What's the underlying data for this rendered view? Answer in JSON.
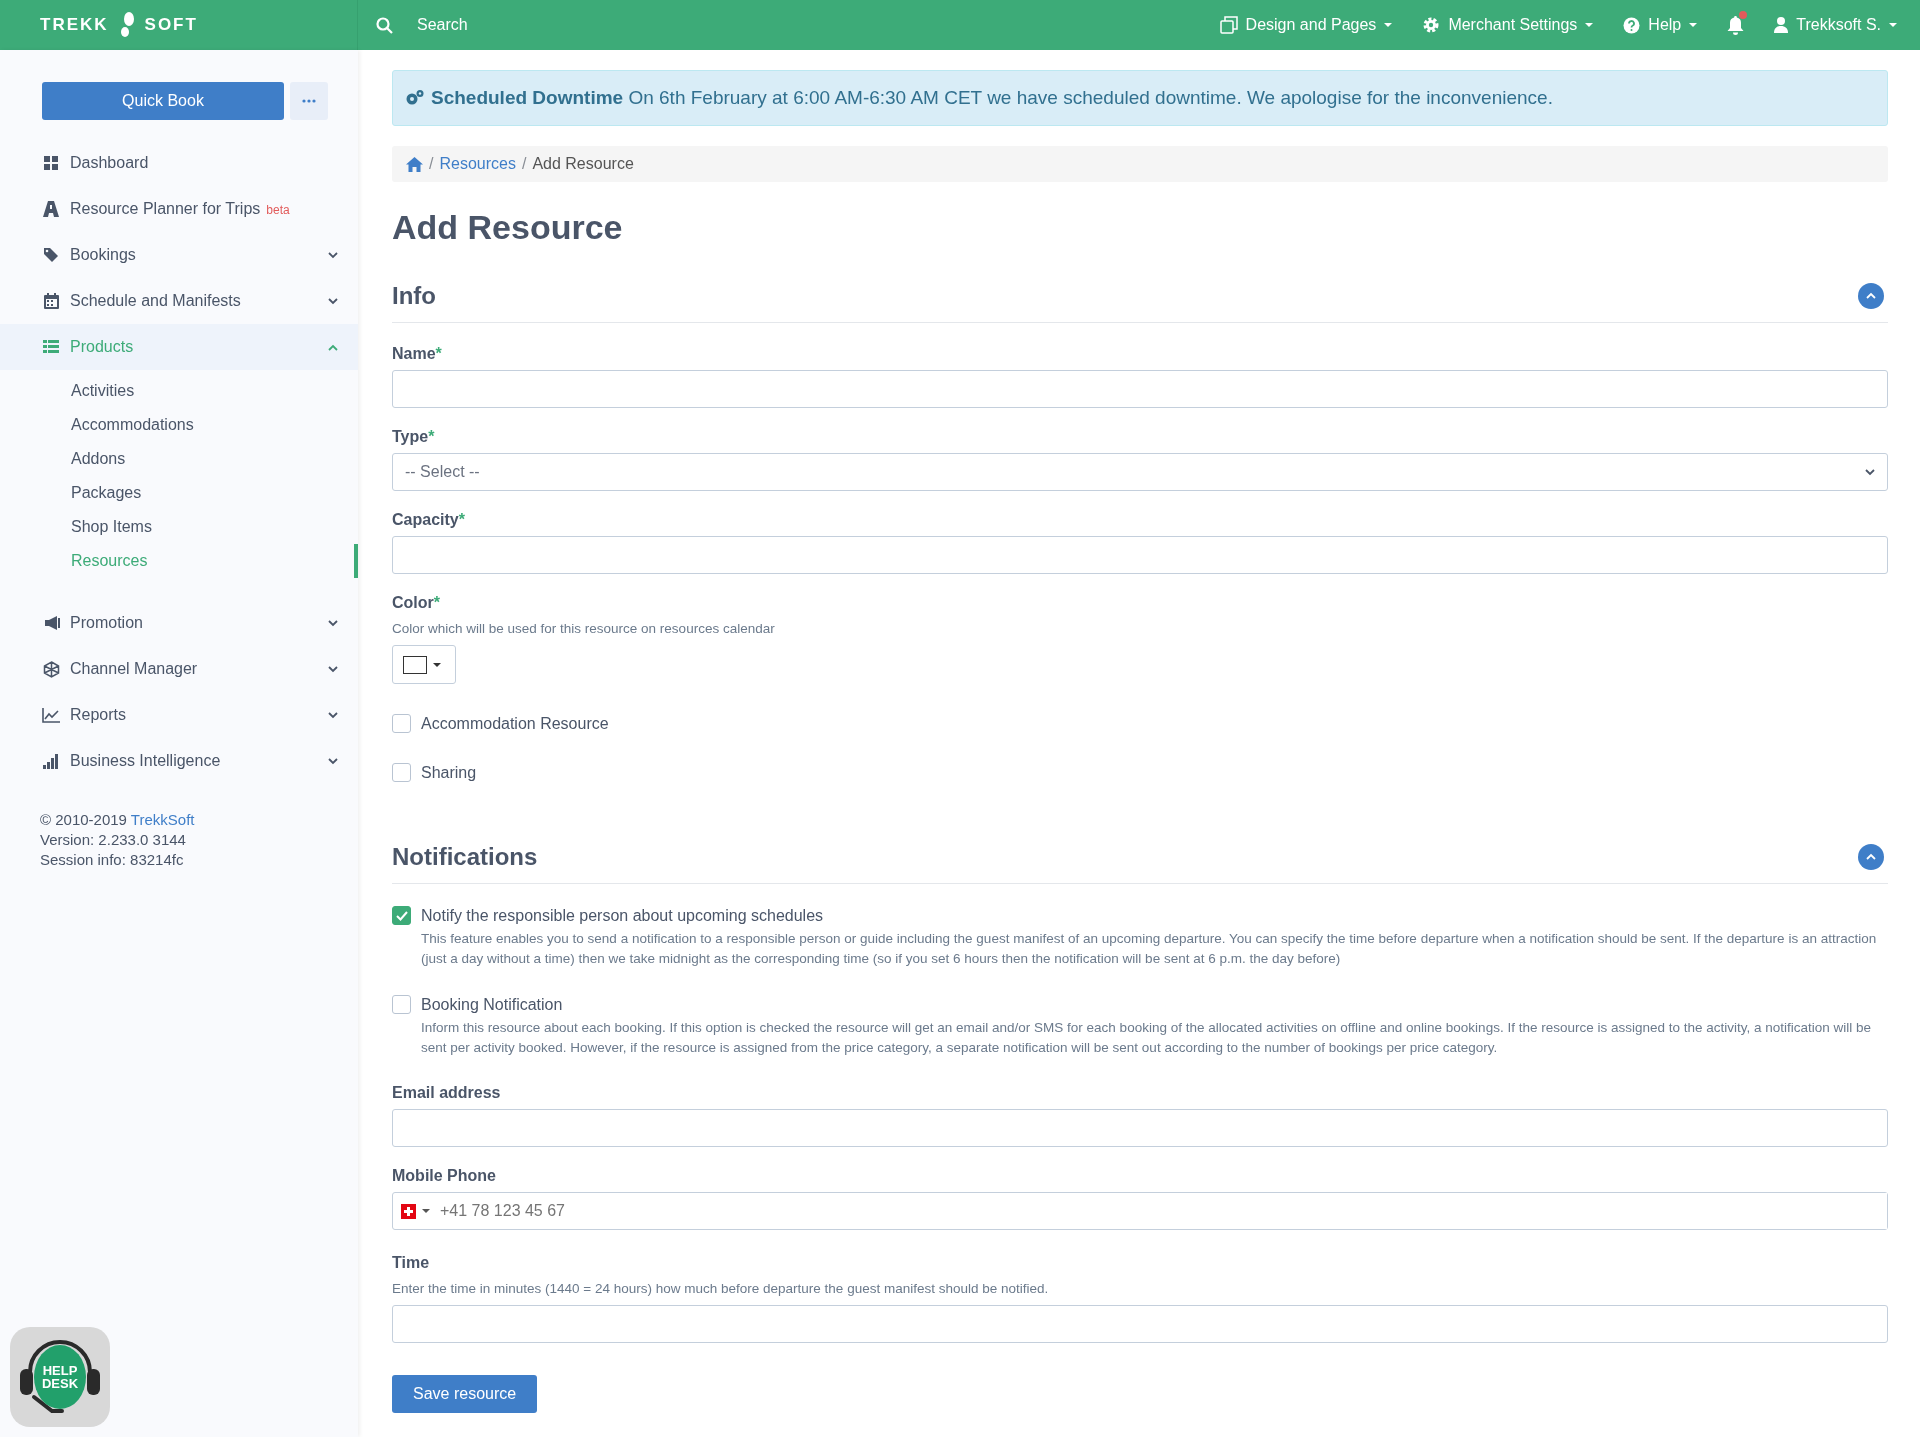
{
  "topbar": {
    "logo": {
      "left": "TREKK",
      "right": "SOFT"
    },
    "search": {
      "placeholder": "Search"
    },
    "nav": [
      {
        "label": "Design and Pages"
      },
      {
        "label": "Merchant Settings"
      },
      {
        "label": "Help"
      }
    ],
    "bell": {
      "unread": true
    },
    "user": {
      "label": "Trekksoft S."
    }
  },
  "sidebar": {
    "quick_book": "Quick Book",
    "items": [
      {
        "kind": "link",
        "label": "Dashboard",
        "selected": false
      },
      {
        "kind": "link",
        "label": "Resource Planner for Trips",
        "badge": "beta",
        "selected": false
      },
      {
        "kind": "group",
        "label": "Bookings",
        "expanded": false,
        "selected": false
      },
      {
        "kind": "group",
        "label": "Schedule and Manifests",
        "expanded": false,
        "selected": false
      },
      {
        "kind": "group",
        "label": "Products",
        "expanded": true,
        "selected": true,
        "children": [
          {
            "label": "Activities",
            "selected": false
          },
          {
            "label": "Accommodations",
            "selected": false
          },
          {
            "label": "Addons",
            "selected": false
          },
          {
            "label": "Packages",
            "selected": false
          },
          {
            "label": "Shop Items",
            "selected": false
          },
          {
            "label": "Resources",
            "selected": true
          }
        ]
      },
      {
        "kind": "group",
        "label": "Promotion",
        "expanded": false,
        "selected": false
      },
      {
        "kind": "group",
        "label": "Channel Manager",
        "expanded": false,
        "selected": false
      },
      {
        "kind": "group",
        "label": "Reports",
        "expanded": false,
        "selected": false
      },
      {
        "kind": "group",
        "label": "Business Intelligence",
        "expanded": false,
        "selected": false
      }
    ],
    "footer": {
      "copyright": "© 2010-2019 ",
      "link": "TrekkSoft",
      "version": "Version: 2.233.0 3144",
      "session": "Session info: 83214fc"
    },
    "help_desk": {
      "line_1": "HELP",
      "line_2": "DESK"
    }
  },
  "alert": {
    "title": "Scheduled Downtime",
    "text": " On 6th February at 6:00 AM-6:30 AM CET we have scheduled downtime. We apologise for the inconvenience."
  },
  "breadcrumb": [
    {
      "separator": "/",
      "label": "Resources",
      "kind": "link"
    },
    {
      "separator": "/",
      "label": "Add Resource",
      "kind": "current"
    }
  ],
  "title": "Add Resource",
  "sections": [
    {
      "title": "Info",
      "expanded": true,
      "fields": [
        {
          "kind": "text",
          "label": "Name",
          "required": "*"
        },
        {
          "kind": "select",
          "label": "Type",
          "required": "*",
          "value": "-- Select --"
        },
        {
          "kind": "text",
          "label": "Capacity",
          "required": "*"
        },
        {
          "kind": "color",
          "label": "Color",
          "required": "*",
          "hint": "Color which will be used for this resource on resources calendar",
          "color": "#ffffff"
        },
        {
          "kind": "checkbox",
          "label": "Accommodation Resource",
          "checked": false
        },
        {
          "kind": "checkbox",
          "label": "Sharing",
          "checked": false
        }
      ]
    },
    {
      "title": "Notifications",
      "expanded": true,
      "fields": [
        {
          "kind": "checkbox",
          "label": "Notify the responsible person about upcoming schedules",
          "checked": true,
          "description": "This feature enables you to send a notification to a responsible person or guide including the guest manifest of an upcoming departure. You can specify the time before departure when a notification should be sent. If the departure is an attraction (just a day without a time) then we take midnight as the corresponding time (so if you set 6 hours then the notification will be sent at 6 p.m. the day before)"
        },
        {
          "kind": "checkbox",
          "label": "Booking Notification",
          "checked": false,
          "description": "Inform this resource about each booking. If this option is checked the resource will get an email and/or SMS for each booking of the allocated activities on offline and online bookings. If the resource is assigned to the activity, a notification will be sent per activity booked. However, if the resource is assigned from the price category, a separate notification will be sent out according to the number of bookings per price category."
        },
        {
          "kind": "text",
          "label": "Email address"
        },
        {
          "kind": "phone",
          "label": "Mobile Phone",
          "placeholder": "+41 78 123 45 67"
        },
        {
          "kind": "text",
          "label": "Time",
          "hint": "Enter the time in minutes (1440 = 24 hours) how much before departure the guest manifest should be notified."
        }
      ]
    }
  ],
  "save_button": "Save resource"
}
